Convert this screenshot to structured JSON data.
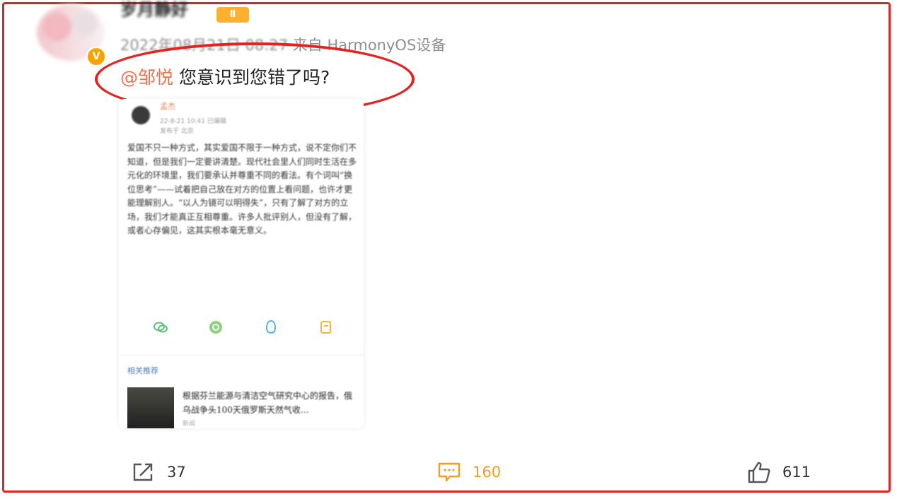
{
  "post": {
    "username": "岁月静好",
    "rank_badge": "Ⅱ",
    "timestamp": "2022年08月21日 08:27",
    "source": "来自 HarmonyOS设备",
    "comment_mention": "@邹悦",
    "comment_text": " 您意识到您错了吗?"
  },
  "card": {
    "author": "孟杰",
    "time": "22-8-21 10:41",
    "time_extra": "已编辑",
    "location": "发布于 北京",
    "body": "爱国不只一种方式，其实爱国不限于一种方式，说不定你们不知道，但是我们一定要讲清楚。现代社会里人们同时生活在多元化的环境里，我们要承认并尊重不同的看法。有个词叫“换位思考”——试着把自己放在对方的位置上看问题，也许才更能理解别人。“以人为镜可以明得失”，只有了解了对方的立场，我们才能真正互相尊重。许多人批评别人，但没有了解，或者心存偏见，这其实根本毫无意义。"
  },
  "related": {
    "label": "相关推荐",
    "title": "根据芬兰能源与清洁空气研究中心的报告，俄乌战争头100天俄罗斯天然气收…",
    "source": "新闻"
  },
  "actions": {
    "repost_count": "37",
    "comment_count": "160",
    "like_count": "611"
  },
  "colors": {
    "frame_red": "#e5221f",
    "mention_orange": "#eb7350",
    "comment_orange": "#f59a23",
    "verified_gold": "#f7a300"
  }
}
